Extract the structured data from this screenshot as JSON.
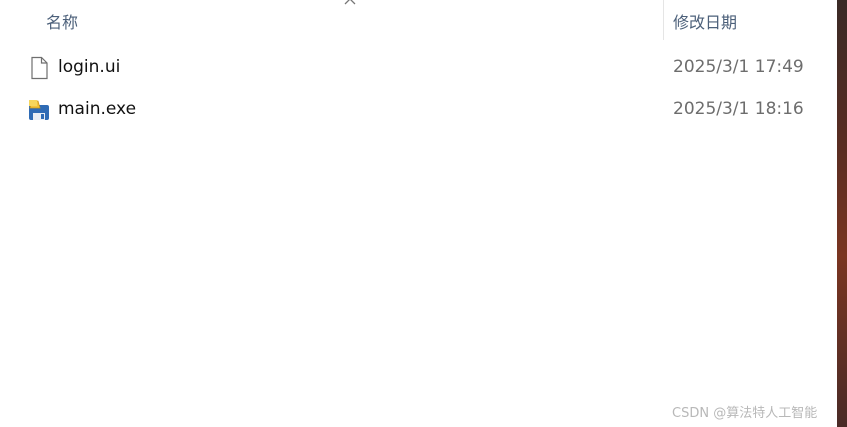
{
  "header": {
    "name_label": "名称",
    "date_label": "修改日期",
    "sort_icon": "chevron-up-icon"
  },
  "files": [
    {
      "name": "login.ui",
      "modified": "2025/3/1 17:49",
      "icon": "document-icon"
    },
    {
      "name": "main.exe",
      "modified": "2025/3/1 18:16",
      "icon": "exe-icon"
    }
  ],
  "watermark": "CSDN @算法特人工智能",
  "colors": {
    "header_text": "#4c607a",
    "date_text": "#6d6d6d"
  }
}
